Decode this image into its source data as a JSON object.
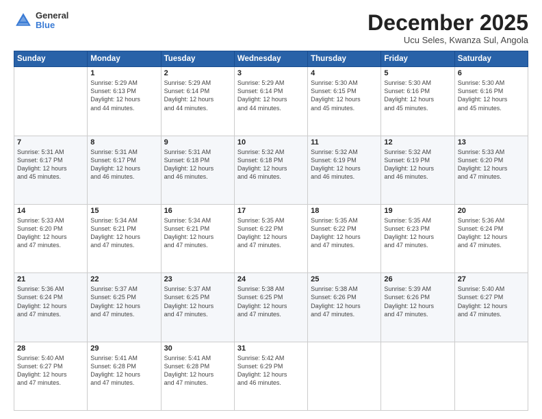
{
  "header": {
    "logo_general": "General",
    "logo_blue": "Blue",
    "month_title": "December 2025",
    "location": "Ucu Seles, Kwanza Sul, Angola"
  },
  "days_of_week": [
    "Sunday",
    "Monday",
    "Tuesday",
    "Wednesday",
    "Thursday",
    "Friday",
    "Saturday"
  ],
  "weeks": [
    [
      {
        "day": "",
        "info": ""
      },
      {
        "day": "1",
        "info": "Sunrise: 5:29 AM\nSunset: 6:13 PM\nDaylight: 12 hours\nand 44 minutes."
      },
      {
        "day": "2",
        "info": "Sunrise: 5:29 AM\nSunset: 6:14 PM\nDaylight: 12 hours\nand 44 minutes."
      },
      {
        "day": "3",
        "info": "Sunrise: 5:29 AM\nSunset: 6:14 PM\nDaylight: 12 hours\nand 44 minutes."
      },
      {
        "day": "4",
        "info": "Sunrise: 5:30 AM\nSunset: 6:15 PM\nDaylight: 12 hours\nand 45 minutes."
      },
      {
        "day": "5",
        "info": "Sunrise: 5:30 AM\nSunset: 6:16 PM\nDaylight: 12 hours\nand 45 minutes."
      },
      {
        "day": "6",
        "info": "Sunrise: 5:30 AM\nSunset: 6:16 PM\nDaylight: 12 hours\nand 45 minutes."
      }
    ],
    [
      {
        "day": "7",
        "info": "Sunrise: 5:31 AM\nSunset: 6:17 PM\nDaylight: 12 hours\nand 45 minutes."
      },
      {
        "day": "8",
        "info": "Sunrise: 5:31 AM\nSunset: 6:17 PM\nDaylight: 12 hours\nand 46 minutes."
      },
      {
        "day": "9",
        "info": "Sunrise: 5:31 AM\nSunset: 6:18 PM\nDaylight: 12 hours\nand 46 minutes."
      },
      {
        "day": "10",
        "info": "Sunrise: 5:32 AM\nSunset: 6:18 PM\nDaylight: 12 hours\nand 46 minutes."
      },
      {
        "day": "11",
        "info": "Sunrise: 5:32 AM\nSunset: 6:19 PM\nDaylight: 12 hours\nand 46 minutes."
      },
      {
        "day": "12",
        "info": "Sunrise: 5:32 AM\nSunset: 6:19 PM\nDaylight: 12 hours\nand 46 minutes."
      },
      {
        "day": "13",
        "info": "Sunrise: 5:33 AM\nSunset: 6:20 PM\nDaylight: 12 hours\nand 47 minutes."
      }
    ],
    [
      {
        "day": "14",
        "info": "Sunrise: 5:33 AM\nSunset: 6:20 PM\nDaylight: 12 hours\nand 47 minutes."
      },
      {
        "day": "15",
        "info": "Sunrise: 5:34 AM\nSunset: 6:21 PM\nDaylight: 12 hours\nand 47 minutes."
      },
      {
        "day": "16",
        "info": "Sunrise: 5:34 AM\nSunset: 6:21 PM\nDaylight: 12 hours\nand 47 minutes."
      },
      {
        "day": "17",
        "info": "Sunrise: 5:35 AM\nSunset: 6:22 PM\nDaylight: 12 hours\nand 47 minutes."
      },
      {
        "day": "18",
        "info": "Sunrise: 5:35 AM\nSunset: 6:22 PM\nDaylight: 12 hours\nand 47 minutes."
      },
      {
        "day": "19",
        "info": "Sunrise: 5:35 AM\nSunset: 6:23 PM\nDaylight: 12 hours\nand 47 minutes."
      },
      {
        "day": "20",
        "info": "Sunrise: 5:36 AM\nSunset: 6:24 PM\nDaylight: 12 hours\nand 47 minutes."
      }
    ],
    [
      {
        "day": "21",
        "info": "Sunrise: 5:36 AM\nSunset: 6:24 PM\nDaylight: 12 hours\nand 47 minutes."
      },
      {
        "day": "22",
        "info": "Sunrise: 5:37 AM\nSunset: 6:25 PM\nDaylight: 12 hours\nand 47 minutes."
      },
      {
        "day": "23",
        "info": "Sunrise: 5:37 AM\nSunset: 6:25 PM\nDaylight: 12 hours\nand 47 minutes."
      },
      {
        "day": "24",
        "info": "Sunrise: 5:38 AM\nSunset: 6:25 PM\nDaylight: 12 hours\nand 47 minutes."
      },
      {
        "day": "25",
        "info": "Sunrise: 5:38 AM\nSunset: 6:26 PM\nDaylight: 12 hours\nand 47 minutes."
      },
      {
        "day": "26",
        "info": "Sunrise: 5:39 AM\nSunset: 6:26 PM\nDaylight: 12 hours\nand 47 minutes."
      },
      {
        "day": "27",
        "info": "Sunrise: 5:40 AM\nSunset: 6:27 PM\nDaylight: 12 hours\nand 47 minutes."
      }
    ],
    [
      {
        "day": "28",
        "info": "Sunrise: 5:40 AM\nSunset: 6:27 PM\nDaylight: 12 hours\nand 47 minutes."
      },
      {
        "day": "29",
        "info": "Sunrise: 5:41 AM\nSunset: 6:28 PM\nDaylight: 12 hours\nand 47 minutes."
      },
      {
        "day": "30",
        "info": "Sunrise: 5:41 AM\nSunset: 6:28 PM\nDaylight: 12 hours\nand 47 minutes."
      },
      {
        "day": "31",
        "info": "Sunrise: 5:42 AM\nSunset: 6:29 PM\nDaylight: 12 hours\nand 46 minutes."
      },
      {
        "day": "",
        "info": ""
      },
      {
        "day": "",
        "info": ""
      },
      {
        "day": "",
        "info": ""
      }
    ]
  ]
}
